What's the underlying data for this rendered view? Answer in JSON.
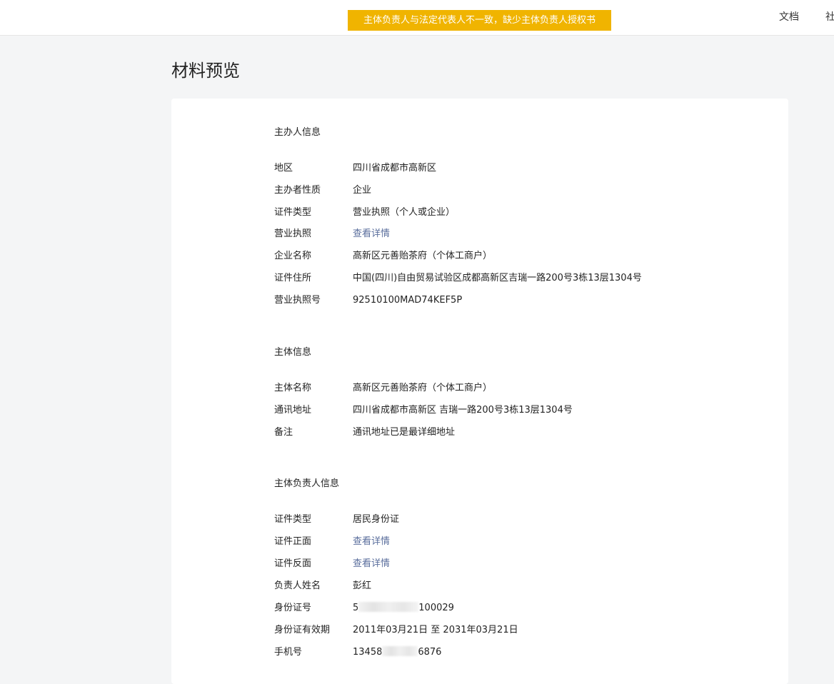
{
  "header": {
    "warning_text": "主体负责人与法定代表人不一致，缺少主体负责人授权书",
    "nav": {
      "docs": "文档",
      "community": "社"
    },
    "warning_color": "#f0b400"
  },
  "page": {
    "title": "材料预览"
  },
  "sections": {
    "organizer": {
      "title": "主办人信息",
      "rows": [
        {
          "label": "地区",
          "value": "四川省成都市高新区"
        },
        {
          "label": "主办者性质",
          "value": "企业"
        },
        {
          "label": "证件类型",
          "value": "营业执照（个人或企业）"
        },
        {
          "label": "营业执照",
          "value": "查看详情"
        },
        {
          "label": "企业名称",
          "value": "高新区元善贻茶府（个体工商户）"
        },
        {
          "label": "证件住所",
          "value": "中国(四川)自由贸易试验区成都高新区吉瑞一路200号3栋13层1304号"
        },
        {
          "label": "营业执照号",
          "value": "92510100MAD74KEF5P"
        }
      ]
    },
    "subject": {
      "title": "主体信息",
      "rows": [
        {
          "label": "主体名称",
          "value": "高新区元善贻茶府（个体工商户）"
        },
        {
          "label": "通讯地址",
          "value": "四川省成都市高新区 吉瑞一路200号3栋13层1304号"
        },
        {
          "label": "备注",
          "value": "通讯地址已是最详细地址"
        }
      ]
    },
    "principal": {
      "title": "主体负责人信息",
      "rows": [
        {
          "label": "证件类型",
          "value": "居民身份证"
        },
        {
          "label": "证件正面",
          "value": "查看详情"
        },
        {
          "label": "证件反面",
          "value": "查看详情"
        },
        {
          "label": "负责人姓名",
          "value": "彭红"
        },
        {
          "label": "身份证号",
          "value_prefix": "5",
          "value_suffix": "100029"
        },
        {
          "label": "身份证有效期",
          "value": "2011年03月21日 至 2031年03月21日"
        },
        {
          "label": "手机号",
          "value_prefix": "13458",
          "value_suffix": "6876"
        }
      ]
    }
  },
  "colors": {
    "link": "#5a6e9c",
    "background": "#f4f5f6",
    "card": "#ffffff"
  }
}
